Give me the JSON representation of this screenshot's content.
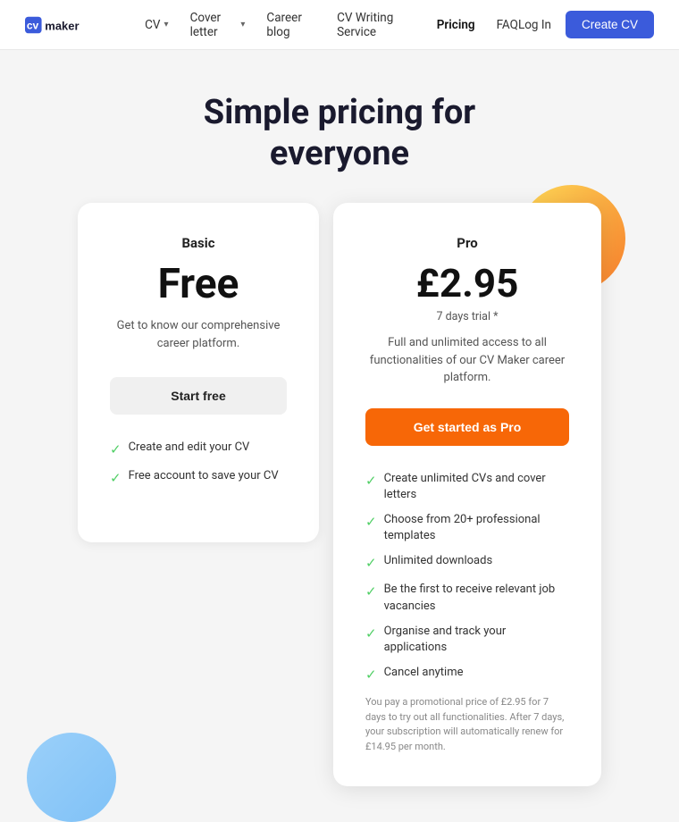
{
  "nav": {
    "logo_text": "cv maker",
    "links": [
      {
        "label": "CV",
        "has_dropdown": true
      },
      {
        "label": "Cover letter",
        "has_dropdown": true
      },
      {
        "label": "Career blog",
        "has_dropdown": false
      },
      {
        "label": "CV Writing Service",
        "has_dropdown": false
      },
      {
        "label": "Pricing",
        "has_dropdown": false,
        "active": true
      },
      {
        "label": "FAQ",
        "has_dropdown": false
      }
    ],
    "login_label": "Log In",
    "cta_label": "Create CV"
  },
  "hero": {
    "line1": "Simple pricing for",
    "line2": "everyone"
  },
  "basic_card": {
    "plan_label": "Basic",
    "price": "Free",
    "description": "Get to know our comprehensive career platform.",
    "cta_label": "Start free",
    "features": [
      "Create and edit your CV",
      "Free account to save your CV"
    ]
  },
  "pro_card": {
    "plan_label": "Pro",
    "price": "£2.95",
    "trial_label": "7 days trial *",
    "description": "Full and unlimited access to all functionalities of our CV Maker career platform.",
    "cta_label": "Get started as Pro",
    "features": [
      "Create unlimited CVs and cover letters",
      "Choose from 20+ professional templates",
      "Unlimited downloads",
      "Be the first to receive relevant job vacancies",
      "Organise and track your applications",
      "Cancel anytime"
    ],
    "footer_note": "You pay a promotional price of £2.95 for 7 days to try out all functionalities.  After 7 days, your subscription will automatically renew for £14.95 per month."
  },
  "icons": {
    "check": "✓",
    "chevron": "▾"
  }
}
